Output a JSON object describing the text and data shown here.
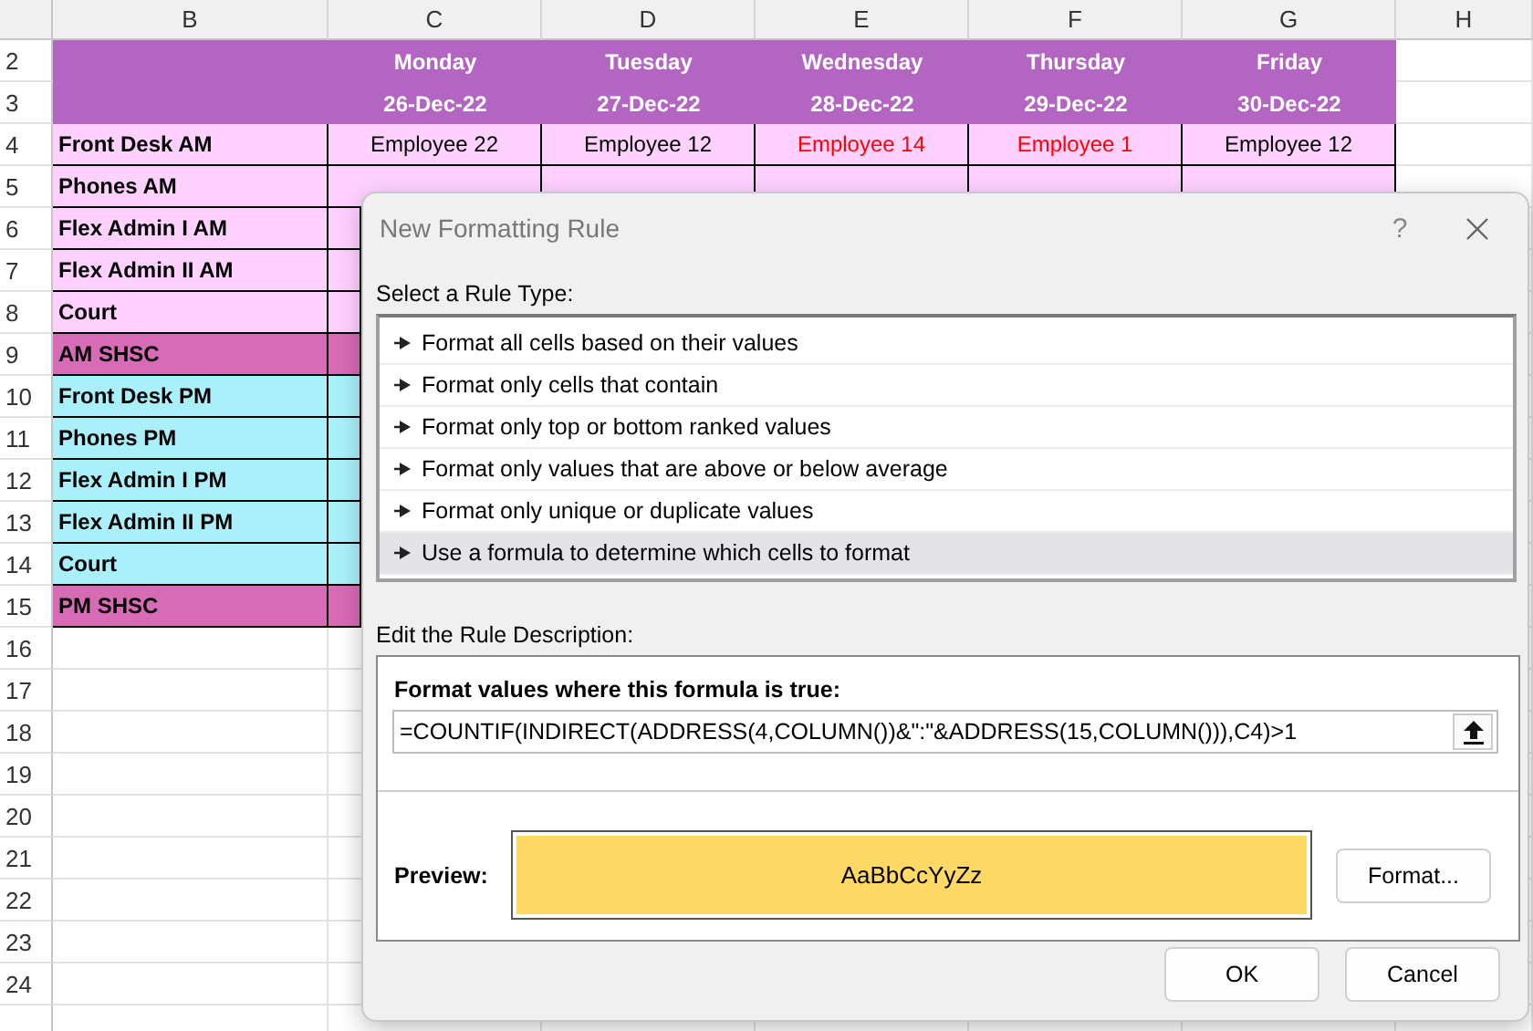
{
  "sheet": {
    "columns": [
      "B",
      "C",
      "D",
      "E",
      "F",
      "G",
      "H"
    ],
    "row_numbers": [
      "2",
      "3",
      "4",
      "5",
      "6",
      "7",
      "8",
      "9",
      "10",
      "11",
      "12",
      "13",
      "14",
      "15",
      "16",
      "17",
      "18",
      "19",
      "20",
      "21",
      "22",
      "23",
      "24"
    ],
    "days": [
      "Monday",
      "Tuesday",
      "Wednesday",
      "Thursday",
      "Friday"
    ],
    "dates": [
      "26-Dec-22",
      "27-Dec-22",
      "28-Dec-22",
      "29-Dec-22",
      "30-Dec-22"
    ],
    "rows": [
      {
        "label": "Front Desk AM",
        "color": "#ffd1ff",
        "cells": [
          {
            "text": "Employee 22",
            "duplicate": false
          },
          {
            "text": "Employee 12",
            "duplicate": false
          },
          {
            "text": "Employee 14",
            "duplicate": true
          },
          {
            "text": "Employee 1",
            "duplicate": true
          },
          {
            "text": "Employee 12",
            "duplicate": false
          }
        ]
      },
      {
        "label": "Phones AM",
        "color": "#ffd1ff"
      },
      {
        "label": "Flex Admin I AM",
        "color": "#ffd1ff"
      },
      {
        "label": "Flex Admin II AM",
        "color": "#ffd1ff"
      },
      {
        "label": "Court",
        "color": "#ffd1ff"
      },
      {
        "label": "AM SHSC",
        "color": "#d86bb6"
      },
      {
        "label": "Front Desk PM",
        "color": "#aaf0fa"
      },
      {
        "label": "Phones PM",
        "color": "#aaf0fa"
      },
      {
        "label": "Flex Admin I PM",
        "color": "#aaf0fa"
      },
      {
        "label": "Flex Admin II PM",
        "color": "#aaf0fa"
      },
      {
        "label": "Court",
        "color": "#aaf0fa"
      },
      {
        "label": "PM SHSC",
        "color": "#d86bb6"
      }
    ]
  },
  "dialog": {
    "title": "New Formatting Rule",
    "help": "?",
    "rule_type_label": "Select a Rule Type:",
    "rule_types": [
      {
        "label": "Format all cells based on their values",
        "selected": false
      },
      {
        "label": "Format only cells that contain",
        "selected": false
      },
      {
        "label": "Format only top or bottom ranked values",
        "selected": false
      },
      {
        "label": "Format only values that are above or below average",
        "selected": false
      },
      {
        "label": "Format only unique or duplicate values",
        "selected": false
      },
      {
        "label": "Use a formula to determine which cells to format",
        "selected": true
      }
    ],
    "description_label": "Edit the Rule Description:",
    "formula_label": "Format values where this formula is true:",
    "formula": "=COUNTIF(INDIRECT(ADDRESS(4,COLUMN())&\":\"&ADDRESS(15,COLUMN())),C4)>1",
    "preview_label": "Preview:",
    "preview_sample": "AaBbCcYyZz",
    "format_button": "Format...",
    "buttons": [
      "OK",
      "Cancel"
    ]
  }
}
